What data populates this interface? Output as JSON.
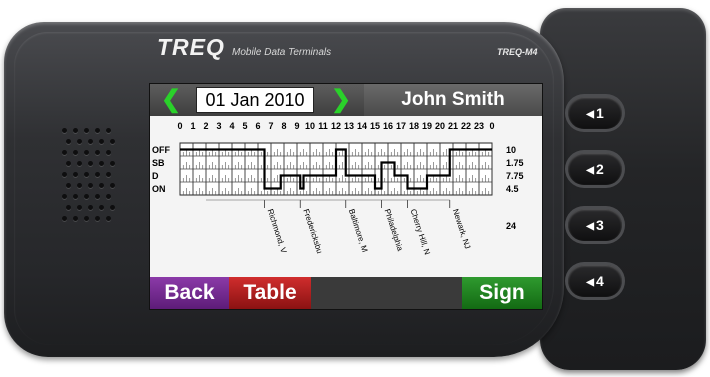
{
  "brand": {
    "logo": "TREQ",
    "subtitle": "Mobile Data Terminals",
    "model": "TREQ-M4"
  },
  "header": {
    "prev_icon": "chevron-left-icon",
    "date": "01 Jan 2010",
    "next_icon": "chevron-right-icon",
    "driver": "John Smith"
  },
  "log": {
    "hours": [
      "0",
      "1",
      "2",
      "3",
      "4",
      "5",
      "6",
      "7",
      "8",
      "9",
      "10",
      "11",
      "12",
      "13",
      "14",
      "15",
      "16",
      "17",
      "18",
      "19",
      "20",
      "21",
      "22",
      "23",
      "0"
    ],
    "statuses": [
      "OFF",
      "SB",
      "D",
      "ON"
    ],
    "totals": [
      "10",
      "1.75",
      "7.75",
      "4.5"
    ],
    "grand_total": "24",
    "status_timeline": [
      {
        "start": 0,
        "end": 6.5,
        "status": "OFF"
      },
      {
        "start": 6.5,
        "end": 7.75,
        "status": "ON"
      },
      {
        "start": 7.75,
        "end": 9.25,
        "status": "D"
      },
      {
        "start": 9.25,
        "end": 9.5,
        "status": "ON"
      },
      {
        "start": 9.5,
        "end": 12,
        "status": "D"
      },
      {
        "start": 12,
        "end": 12.75,
        "status": "OFF"
      },
      {
        "start": 12.75,
        "end": 15,
        "status": "D"
      },
      {
        "start": 15,
        "end": 15.5,
        "status": "ON"
      },
      {
        "start": 15.5,
        "end": 16.5,
        "status": "SB"
      },
      {
        "start": 16.5,
        "end": 17.5,
        "status": "D"
      },
      {
        "start": 17.5,
        "end": 19,
        "status": "ON"
      },
      {
        "start": 19,
        "end": 20.75,
        "status": "D"
      },
      {
        "start": 20.75,
        "end": 24,
        "status": "OFF"
      }
    ],
    "locations": [
      {
        "hour": 6.5,
        "label": "Richmond, V"
      },
      {
        "hour": 9.25,
        "label": "Fredericksbu"
      },
      {
        "hour": 12.75,
        "label": "Baltimore, M"
      },
      {
        "hour": 15.5,
        "label": "Philadelphia"
      },
      {
        "hour": 17.5,
        "label": "Cherry Hill, N"
      },
      {
        "hour": 20.75,
        "label": "Newark, NJ"
      }
    ]
  },
  "footer": {
    "back": "Back",
    "table": "Table",
    "sign": "Sign"
  },
  "side_buttons": [
    {
      "label": "1",
      "icon": "triangle-left-icon"
    },
    {
      "label": "2",
      "icon": "triangle-left-icon"
    },
    {
      "label": "3",
      "icon": "triangle-left-icon"
    },
    {
      "label": "4",
      "icon": "triangle-left-icon"
    }
  ],
  "colors": {
    "nav_arrow": "#2ad12a",
    "back": "#6f2a8e",
    "table": "#b01e1e",
    "sign": "#1d7d1d"
  }
}
